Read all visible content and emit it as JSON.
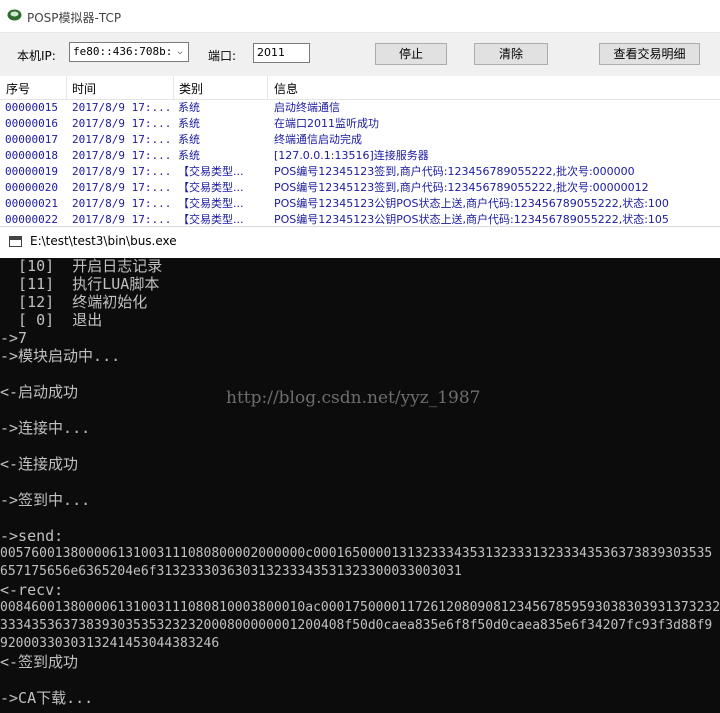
{
  "posp": {
    "title": "POSP模拟器-TCP",
    "ip_label": "本机IP:",
    "ip_value": "fe80::436:708b:8",
    "port_label": "端口:",
    "port_value": "2011",
    "stop_label": "停止",
    "clear_label": "清除",
    "details_label": "查看交易明细",
    "columns": [
      "序号",
      "时间",
      "类别",
      "信息"
    ],
    "rows": [
      {
        "seq": "00000015",
        "time": "2017/8/9 17:...",
        "cat": "系统",
        "info": "启动终端通信"
      },
      {
        "seq": "00000016",
        "time": "2017/8/9 17:...",
        "cat": "系统",
        "info": "在端口2011监听成功"
      },
      {
        "seq": "00000017",
        "time": "2017/8/9 17:...",
        "cat": "系统",
        "info": "终端通信启动完成"
      },
      {
        "seq": "00000018",
        "time": "2017/8/9 17:...",
        "cat": "系统",
        "info": "[127.0.0.1:13516]连接服务器"
      },
      {
        "seq": "00000019",
        "time": "2017/8/9 17:...",
        "cat": "【交易类型...",
        "info": "POS编号12345123签到,商户代码:123456789055222,批次号:000000"
      },
      {
        "seq": "00000020",
        "time": "2017/8/9 17:...",
        "cat": "【交易类型...",
        "info": "POS编号12345123签到,商户代码:123456789055222,批次号:00000012"
      },
      {
        "seq": "00000021",
        "time": "2017/8/9 17:...",
        "cat": "【交易类型...",
        "info": "POS编号12345123公钥POS状态上送,商户代码:123456789055222,状态:100"
      },
      {
        "seq": "00000022",
        "time": "2017/8/9 17:...",
        "cat": "【交易类型...",
        "info": "POS编号12345123公钥POS状态上送,商户代码:123456789055222,状态:105"
      }
    ]
  },
  "console": {
    "title": "E:\\test\\test3\\bin\\bus.exe",
    "watermark": "http://blog.csdn.net/yyz_1987",
    "lines": [
      "  [10]  开启日志记录",
      "  [11]  执行LUA脚本",
      "  [12]  终端初始化",
      "  [ 0]  退出",
      "->7",
      "->模块启动中...",
      "",
      "<-启动成功",
      "",
      "->连接中...",
      "",
      "<-连接成功",
      "",
      "->签到中...",
      "",
      "->send:",
      "005760013800006131003111080800002000000c000165000013132333435313233313233343536373839303535",
      "657175656e6365204e6f313233303630313233343531323300033003031",
      "<-recv:",
      "008460013800006131003111080810003800010ac000175000011726120809081234567859593038303931373232",
      "33343536373839303535323232000800000001200408f50d0caea835e6f8f50d0caea835e6f34207fc93f3d88f9",
      "9200033030313241453044383246",
      "<-签到成功",
      "",
      "->CA下载..."
    ]
  }
}
